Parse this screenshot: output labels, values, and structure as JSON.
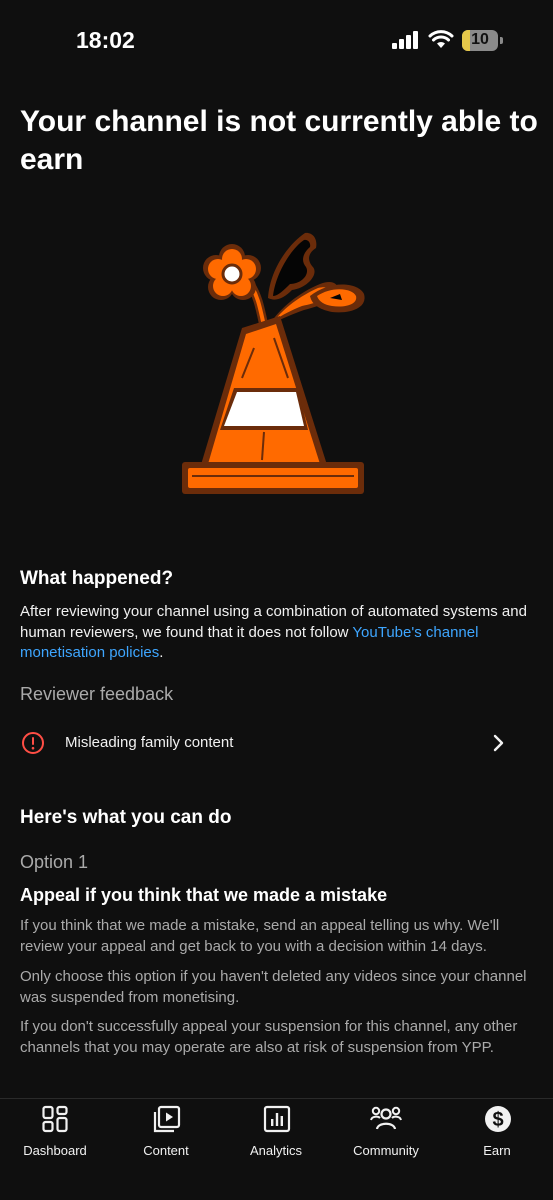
{
  "status_bar": {
    "time": "18:02",
    "battery_level": "10",
    "battery_fraction": 0.1
  },
  "page": {
    "title": "Your channel is not currently able to earn"
  },
  "what_happened": {
    "heading": "What happened?",
    "text_before_link": "After reviewing your channel using a combination of automated systems and human reviewers, we found that it does not follow ",
    "link_text": "YouTube's channel monetisation policies",
    "text_after_link": "."
  },
  "reviewer_feedback": {
    "heading": "Reviewer feedback",
    "items": [
      {
        "label": "Misleading family content",
        "icon": "alert-circle-icon"
      }
    ]
  },
  "what_you_can_do": {
    "heading": "Here's what you can do",
    "option_label": "Option 1",
    "option_title": "Appeal if you think that we made a mistake",
    "paragraphs": [
      "If you think that we made a mistake, send an appeal telling us why. We'll review your appeal and get back to you with a decision within 14 days.",
      "Only choose this option if you haven't deleted any videos since your channel was suspended from monetising.",
      "If you don't successfully appeal your suspension for this channel, any other channels that you may operate are also at risk of suspension from YPP."
    ]
  },
  "bottom_nav": {
    "items": [
      {
        "label": "Dashboard",
        "icon": "dashboard-icon"
      },
      {
        "label": "Content",
        "icon": "content-icon"
      },
      {
        "label": "Analytics",
        "icon": "analytics-icon"
      },
      {
        "label": "Community",
        "icon": "community-icon"
      },
      {
        "label": "Earn",
        "icon": "earn-icon",
        "active": true
      }
    ]
  },
  "colors": {
    "background": "#0f0f0f",
    "link": "#3ea6ff",
    "alert": "#ff4e45",
    "cone_orange": "#ff6a00",
    "cone_outline": "#6b2c0a"
  }
}
